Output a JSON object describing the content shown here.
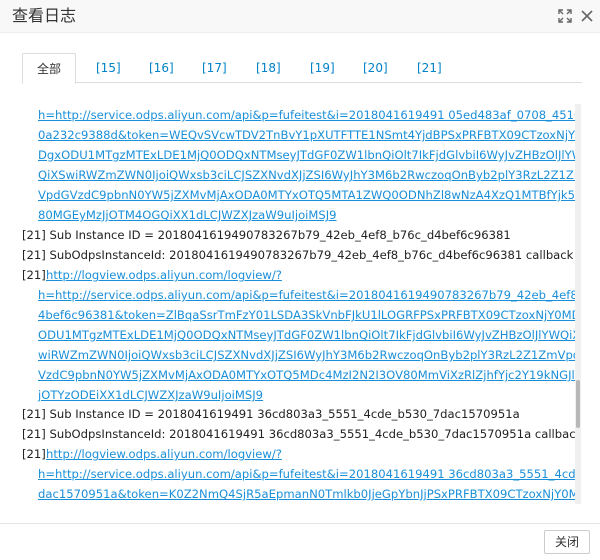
{
  "dialog": {
    "title": "查看日志",
    "icons": {
      "maximize": "maximize-icon",
      "close": "close-icon"
    }
  },
  "tabs": [
    "全部",
    "[15]",
    "[16]",
    "[17]",
    "[18]",
    "[19]",
    "[20]",
    "[21]"
  ],
  "active_tab": "全部",
  "log": {
    "block1_lines": [
      "h=http://service.odps.aliyun.com/api&p=fufeitest&i=2018041619491 05ed483af_0708_4510_b995_4",
      "0a232c9388d&token=WEQvSVcwTDV2TnBvY1pXUTFTTE1NSmt4YjdBPSxPRFBTX09CTzoxNjY0MDg",
      "DgxODU1MTgzMTExLDE1MjQ0ODQxNTMseyJTdGF0ZW1lbnQiOlt7IkFjdGlvbiI6WyJvZHBzOlJlYW",
      "QiXSwiRWZmZWN0IjoiQWxsb3ciLCJSZXNvdXJjZSI6WyJhY3M6b2RwczoqOnByb2plY3RzL2Z1Zm",
      "VpdGVzdC9pbnN0YW5jZXMvMjAxODA0MTYxOTQ5MTA1ZWQ0ODNhZl8wNzA4XzQ1MTBfYjk5NV",
      "80MGEyMzJjOTM4OGQiXX1dLCJWZXJzaW9uIjoiMSJ9"
    ],
    "sub_instance_1": "[21] Sub Instance ID = 2018041619490783267b79_42eb_4ef8_b76c_d4bef6c96381",
    "sub_odps_1": "[21] SubOdpsInstanceId: 2018041619490783267b79_42eb_4ef8_b76c_d4bef6c96381 callback succ",
    "prefix_2": "[21]",
    "link_head_2": "http://logview.odps.aliyun.com/logview/?",
    "block2_lines": [
      "h=http://service.odps.aliyun.com/api&p=fufeitest&i=2018041619490783267b79_42eb_4ef8_b76c_d",
      "4bef6c96381&token=ZlBqaSsrTmFzY01LSDA3SkVnbFJkU1lLOGRFPSxPRFBTX09CTzoxNjY0MDgx",
      "ODU1MTgzMTExLDE1MjQ0ODQxNTMseyJTdGF0ZW1lbnQiOlt7IkFjdGlvbiI6WyJvZHBzOlJlYWQiXS",
      "wiRWZmZWN0IjoiQWxsb3ciLCJSZXNvdXJjZSI6WyJhY3M6b2RwczoqOnByb2plY3RzL2Z1ZmVpdG",
      "VzdC9pbnN0YW5jZXMvMjAxODA0MTYxOTQ5MDc4MzI2N2I3OV80MmViXzRlZjhfYjc2Y19kNGJlZjZ",
      "jOTYzODEiXX1dLCJWZXJzaW9uIjoiMSJ9"
    ],
    "sub_instance_2": "[21] Sub Instance ID = 2018041619491 36cd803a3_5551_4cde_b530_7dac1570951a",
    "sub_odps_2": "[21] SubOdpsInstanceId: 2018041619491 36cd803a3_5551_4cde_b530_7dac1570951a callback succ",
    "prefix_3": "[21]",
    "link_head_3": "http://logview.odps.aliyun.com/logview/?",
    "block3_lines": [
      "h=http://service.odps.aliyun.com/api&p=fufeitest&i=2018041619491 36cd803a3_5551_4cde_b530_7",
      "dac1570951a&token=K0Z2NmQ4SjR5aEpmanN0Tmlkb0JjeGpYbnJjPSxPRFBTX09CTzoxNjY0MDg"
    ]
  },
  "footer": {
    "close_label": "关闭"
  }
}
